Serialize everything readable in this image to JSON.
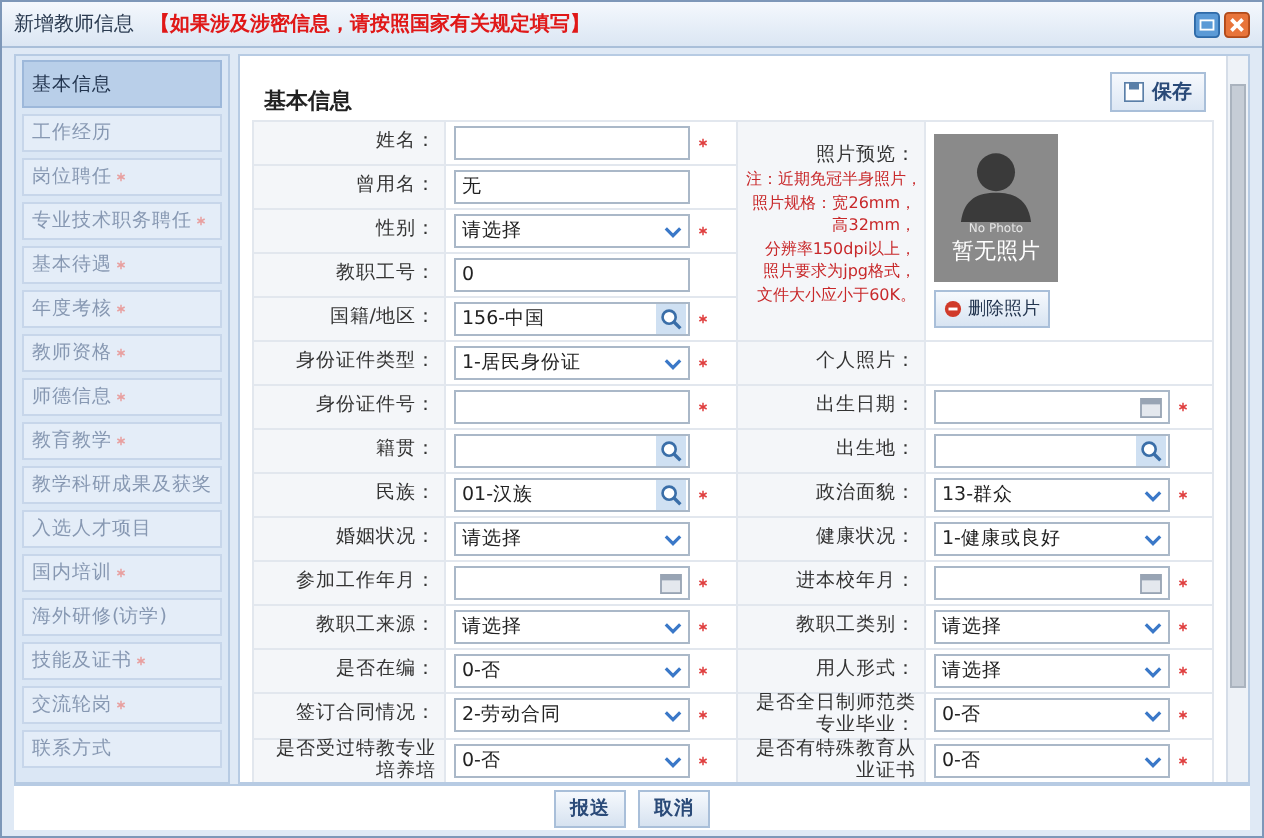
{
  "window": {
    "title": "新增教师信息",
    "notice": "【如果涉及涉密信息，请按照国家有关规定填写】"
  },
  "sidebar": {
    "items": [
      {
        "label": "基本信息",
        "selected": true,
        "required": false
      },
      {
        "label": "工作经历",
        "selected": false,
        "required": false
      },
      {
        "label": "岗位聘任",
        "selected": false,
        "required": true
      },
      {
        "label": "专业技术职务聘任",
        "selected": false,
        "required": true
      },
      {
        "label": "基本待遇",
        "selected": false,
        "required": true
      },
      {
        "label": "年度考核",
        "selected": false,
        "required": true
      },
      {
        "label": "教师资格",
        "selected": false,
        "required": true
      },
      {
        "label": "师德信息",
        "selected": false,
        "required": true
      },
      {
        "label": "教育教学",
        "selected": false,
        "required": true
      },
      {
        "label": "教学科研成果及获奖",
        "selected": false,
        "required": false
      },
      {
        "label": "入选人才项目",
        "selected": false,
        "required": false
      },
      {
        "label": "国内培训",
        "selected": false,
        "required": true
      },
      {
        "label": "海外研修(访学)",
        "selected": false,
        "required": false
      },
      {
        "label": "技能及证书",
        "selected": false,
        "required": true
      },
      {
        "label": "交流轮岗",
        "selected": false,
        "required": true
      },
      {
        "label": "联系方式",
        "selected": false,
        "required": false
      }
    ]
  },
  "section": {
    "title": "基本信息",
    "save_button": "保存"
  },
  "photo": {
    "label": "照片预览：",
    "notes": [
      "注：近期免冠半身照片，",
      "照片规格：宽26mm，",
      "高32mm，",
      "分辨率150dpi以上，",
      "照片要求为jpg格式，",
      "文件大小应小于60K。"
    ],
    "caption": "No Photo",
    "placeholder": "暂无照片",
    "delete_button": "删除照片"
  },
  "form": {
    "rows": [
      {
        "left": {
          "label": "姓名：",
          "kind": "text",
          "required": true
        }
      },
      {
        "left": {
          "label": "曾用名：",
          "kind": "text",
          "value": "无",
          "required": false
        }
      },
      {
        "left": {
          "label": "性别：",
          "kind": "select",
          "value": "请选择",
          "required": true
        }
      },
      {
        "left": {
          "label": "教职工号：",
          "kind": "text",
          "value": "0",
          "required": false
        }
      },
      {
        "left": {
          "label": "国籍/地区：",
          "kind": "lookup",
          "value": "156-中国",
          "required": true
        }
      },
      {
        "left": {
          "label": "身份证件类型：",
          "kind": "select",
          "value": "1-居民身份证",
          "required": true
        },
        "right": {
          "label": "个人照片：",
          "kind": "none",
          "required": false
        }
      },
      {
        "left": {
          "label": "身份证件号：",
          "kind": "text",
          "required": true
        },
        "right": {
          "label": "出生日期：",
          "kind": "date",
          "required": true
        }
      },
      {
        "left": {
          "label": "籍贯：",
          "kind": "lookup",
          "required": false
        },
        "right": {
          "label": "出生地：",
          "kind": "lookup",
          "required": false
        }
      },
      {
        "left": {
          "label": "民族：",
          "kind": "lookup",
          "value": "01-汉族",
          "required": true
        },
        "right": {
          "label": "政治面貌：",
          "kind": "select",
          "value": "13-群众",
          "required": true
        }
      },
      {
        "left": {
          "label": "婚姻状况：",
          "kind": "select",
          "value": "请选择",
          "required": false
        },
        "right": {
          "label": "健康状况：",
          "kind": "select",
          "value": "1-健康或良好",
          "required": false
        }
      },
      {
        "left": {
          "label": "参加工作年月：",
          "kind": "date",
          "required": true
        },
        "right": {
          "label": "进本校年月：",
          "kind": "date",
          "required": true
        }
      },
      {
        "left": {
          "label": "教职工来源：",
          "kind": "select",
          "value": "请选择",
          "required": true
        },
        "right": {
          "label": "教职工类别：",
          "kind": "select",
          "value": "请选择",
          "required": true
        }
      },
      {
        "left": {
          "label": "是否在编：",
          "kind": "select",
          "value": "0-否",
          "required": true
        },
        "right": {
          "label": "用人形式：",
          "kind": "select",
          "value": "请选择",
          "required": true
        }
      },
      {
        "left": {
          "label": "签订合同情况：",
          "kind": "select",
          "value": "2-劳动合同",
          "required": true
        },
        "right": {
          "label": "是否全日制师范类专业毕业：",
          "kind": "select",
          "value": "0-否",
          "required": true
        }
      },
      {
        "left": {
          "label": "是否受过特教专业培养培",
          "kind": "select",
          "value": "0-否",
          "required": true
        },
        "right": {
          "label": "是否有特殊教育从业证书",
          "kind": "select",
          "value": "0-否",
          "required": true
        }
      }
    ]
  },
  "footer": {
    "buttons": [
      "报送",
      "取消"
    ]
  }
}
